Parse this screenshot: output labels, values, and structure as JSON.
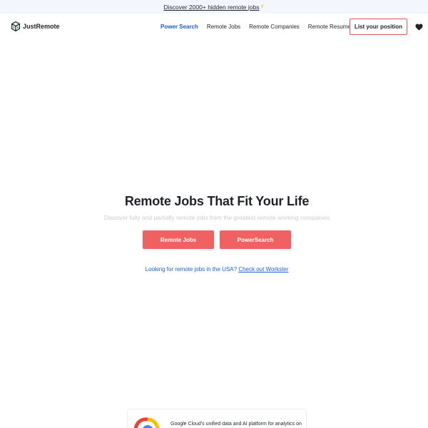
{
  "announcement": {
    "text": "Discover 2000+ hidden remote jobs",
    "icon": "lightning-icon",
    "icon_color": "#f5b400"
  },
  "header": {
    "logo_text": "JustRemote",
    "nav": [
      {
        "label": "Power Search",
        "active": true
      },
      {
        "label": "Remote Jobs",
        "active": false
      },
      {
        "label": "Remote Companies",
        "active": false
      },
      {
        "label": "Remote Resume",
        "active": false
      }
    ],
    "cta_label": "List your position",
    "favorites_icon": "heart-icon"
  },
  "hero": {
    "title": "Remote Jobs That Fit Your Life",
    "subtitle": "Discover fully and partially remote jobs from the greatest remote working companies",
    "buttons": [
      {
        "label": "Remote Jobs"
      },
      {
        "label": "PowerSearch"
      }
    ],
    "usa_prefix": "Looking for remote jobs in the USA?",
    "usa_link": "Check out Workster"
  },
  "ad": {
    "logo": "google-cloud-icon",
    "text": "Google Cloud's unified data and AI platform for analytics on"
  },
  "colors": {
    "accent_blue": "#1d5fd6",
    "cta_red": "#f06262",
    "announcement_bg": "#f3f6fe"
  }
}
